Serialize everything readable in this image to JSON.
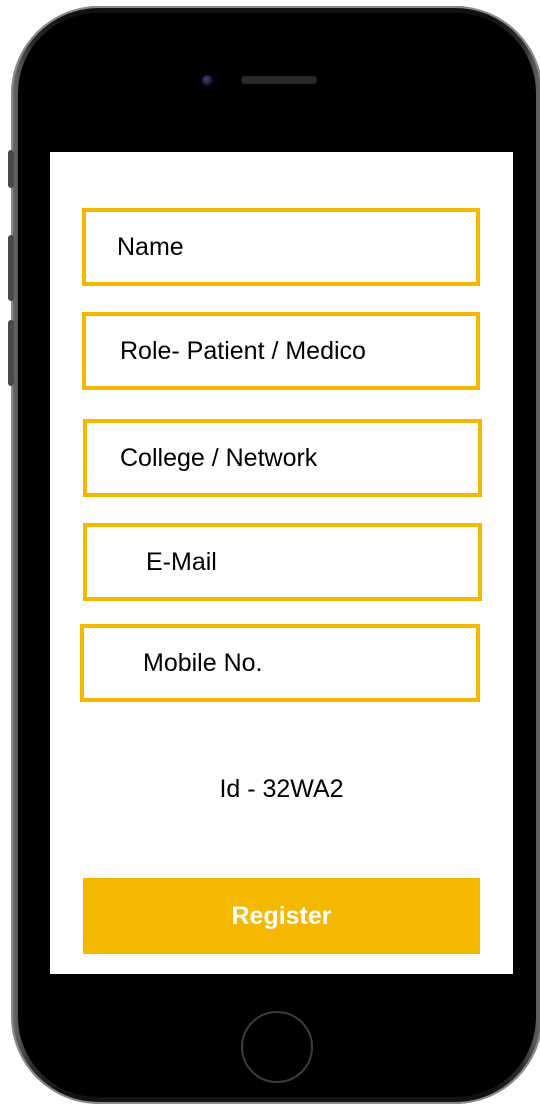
{
  "form": {
    "name_placeholder": "Name",
    "role_placeholder": "Role- Patient / Medico",
    "college_placeholder": "College / Network",
    "email_placeholder": "E-Mail",
    "mobile_placeholder": "Mobile No."
  },
  "id_text": "Id - 32WA2",
  "register_label": "Register",
  "colors": {
    "accent": "#f5b800",
    "button_text": "#ffffff",
    "device_body": "#111111"
  },
  "icons": {
    "camera": "front-camera-icon",
    "speaker": "speaker-grille-icon",
    "home": "home-button-icon"
  }
}
